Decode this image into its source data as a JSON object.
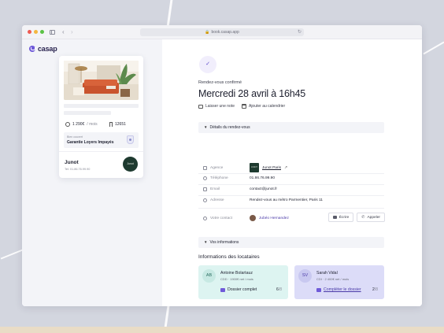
{
  "browser": {
    "url": "book.casap.app"
  },
  "brand": {
    "name": "casap",
    "accent": "#6f5ad9"
  },
  "listing": {
    "price": "1 290€",
    "price_unit": "/ mois",
    "reference": "12651",
    "guarantee_label": "Bien couvert",
    "guarantee_title": "Garantie Loyers Impayés",
    "agency_name": "Junot",
    "agency_tel": "Tel: 01.86.76.99.90",
    "agency_logo_text": "Junot"
  },
  "appointment": {
    "status": "Rendez-vous confirmé",
    "date": "Mercredi 28 avril à 16h45",
    "actions": {
      "note": "Laisser une note",
      "calendar": "Ajouter au calendrier"
    },
    "details_title": "Détails du rendez-vous",
    "rows": {
      "agency": {
        "label": "Agence",
        "value": "Junot Paris"
      },
      "phone": {
        "label": "Téléphone",
        "value": "01.86.76.99.90"
      },
      "email": {
        "label": "Email",
        "value": "contact@junot.fr"
      },
      "address": {
        "label": "Adresse",
        "value": "Rendez-vous au métro Parmentier, Paris 11"
      },
      "contact": {
        "label": "Votre contact",
        "value": "Jubéo Hernandez"
      }
    },
    "write_button": "Écrire",
    "call_button": "Appeler",
    "info_title": "Vos informations"
  },
  "tenants": {
    "title": "Informations des locataires",
    "items": [
      {
        "initials": "AB",
        "name": "Antoine Bolartauz",
        "contract": "CDD",
        "income": "1900€ net / mois",
        "action": "Dossier complet",
        "done": "6",
        "total": "/8"
      },
      {
        "initials": "SV",
        "name": "Sarah Vidal",
        "contract": "CDI",
        "income": "2 400€ net / mois",
        "action": "Compléter le dossier",
        "done": "2",
        "total": "/8"
      }
    ]
  }
}
